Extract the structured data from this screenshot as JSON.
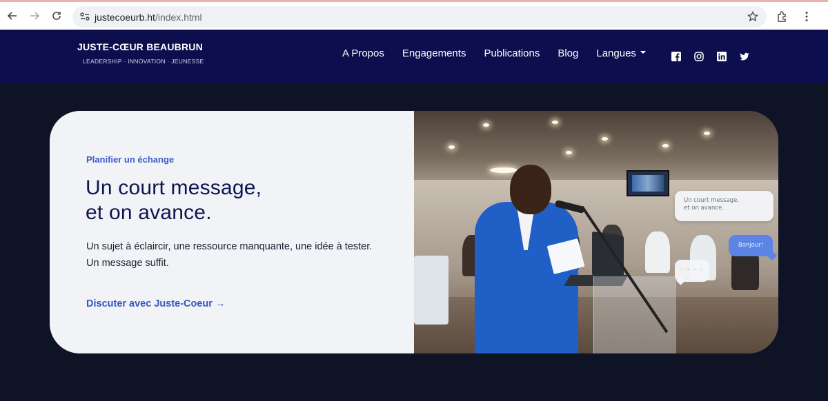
{
  "browser": {
    "url_host": "justecoeurb.ht",
    "url_path": "/index.html"
  },
  "brand": {
    "name": "JUSTE-CŒUR BEAUBRUN",
    "tagline": "LEADERSHIP · INNOVATION · JEUNESSE"
  },
  "nav": {
    "items": [
      {
        "label": "A Propos"
      },
      {
        "label": "Engagements"
      },
      {
        "label": "Publications"
      },
      {
        "label": "Blog"
      },
      {
        "label": "Langues"
      }
    ]
  },
  "socials": [
    "facebook-icon",
    "instagram-icon",
    "linkedin-icon",
    "twitter-icon"
  ],
  "hero": {
    "eyebrow": "Planifier un échange",
    "headline_line1": "Un court message,",
    "headline_line2": "et on avance.",
    "body": "Un sujet à éclaircir, une ressource manquante, une idée à tester. Un message suffit.",
    "cta": "Discuter avec Juste-Coeur →"
  },
  "chat": {
    "bubble1_line1": "Un court message,",
    "bubble1_line2": "et on avance.",
    "bubble2": "Bonjour!",
    "bubble3": "· · · ·"
  },
  "colors": {
    "header_bg": "#0c0e4e",
    "page_bg": "#0f1326",
    "accent": "#3d5fc9",
    "headline": "#0d1550"
  }
}
